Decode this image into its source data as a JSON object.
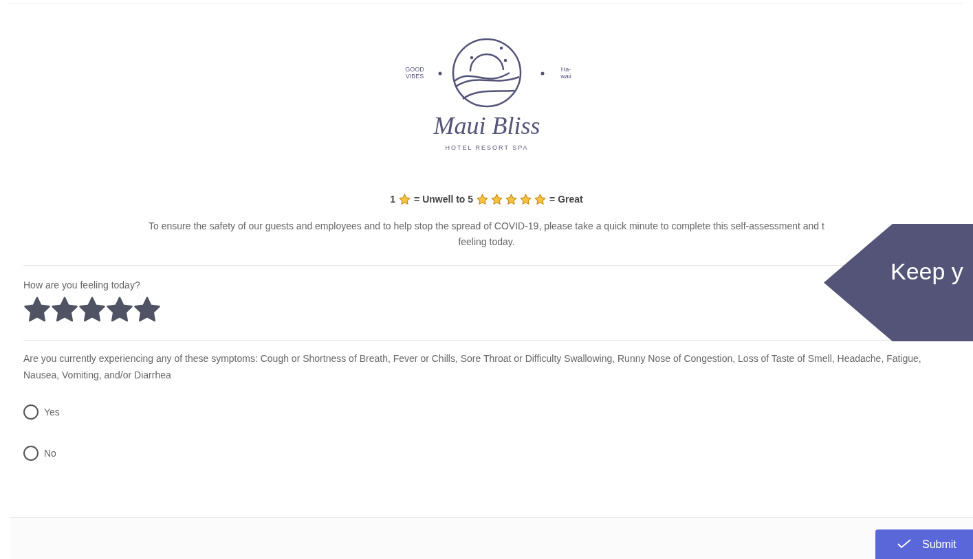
{
  "logo": {
    "left_tag": [
      "GOOD",
      "VIBES"
    ],
    "right_tag": [
      "Ha-",
      "waii"
    ],
    "name": "Maui Bliss",
    "tagline": "HOTEL RESORT SPA"
  },
  "scale_legend": {
    "low": "1",
    "low_label": "= Unwell to 5",
    "high_label": "= Great"
  },
  "intro": [
    "To ensure the safety of our guests and employees and to help stop the spread of COVID-19, please take a quick minute to complete this self-assessment and t",
    "feeling today."
  ],
  "side_tab": {
    "text": "Keep y"
  },
  "questions": [
    {
      "kind": "rating",
      "label": "How are you feeling today?",
      "stars": 5
    },
    {
      "kind": "radio",
      "label": "Are you currently experiencing any of these symptoms: Cough or Shortness of Breath, Fever or Chills, Sore Throat or Difficulty Swallowing, Runny Nose of Congestion, Loss of Taste of Smell, Headache, Fatigue, Nausea, Vomiting, and/or Diarrhea",
      "options": [
        {
          "label": "Yes",
          "selected": false
        },
        {
          "label": "No",
          "selected": false
        }
      ]
    }
  ],
  "submit": {
    "label": "Submit"
  }
}
